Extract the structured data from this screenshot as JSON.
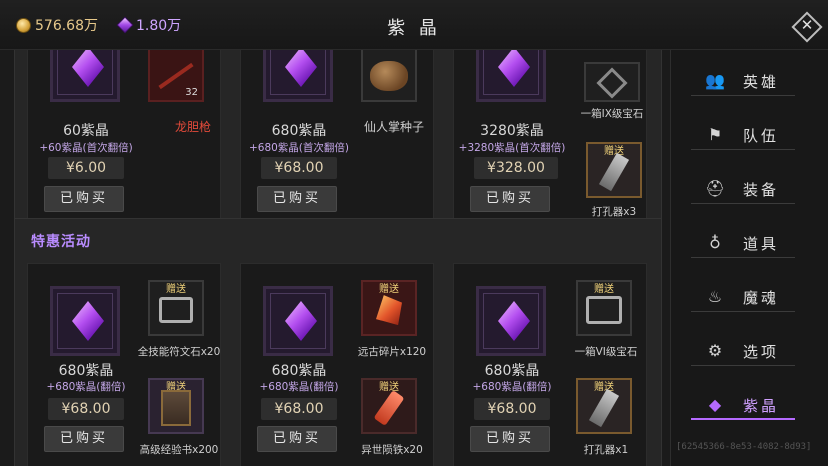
{
  "header": {
    "gold": "576.68万",
    "gems": "1.80万",
    "title": "紫 晶",
    "close": "✕"
  },
  "top_cards": [
    {
      "amount": "60紫晶",
      "bonus": "+60紫晶(首次翻倍)",
      "price": "¥6.00",
      "button": "已购买",
      "gift": {
        "name": "龙胆枪",
        "count": "32",
        "name_color": "#e24a3a"
      }
    },
    {
      "amount": "680紫晶",
      "bonus": "+680紫晶(首次翻倍)",
      "price": "¥68.00",
      "button": "已购买",
      "gift": {
        "name": "仙人掌种子"
      }
    },
    {
      "amount": "3280紫晶",
      "bonus": "+3280紫晶(首次翻倍)",
      "price": "¥328.00",
      "button": "已购买",
      "gift1": {
        "name": "一箱IX级宝石"
      },
      "gift2": {
        "tag": "赠送",
        "name": "打孔器x3"
      }
    }
  ],
  "special": {
    "title": "特惠活动",
    "cards": [
      {
        "amount": "680紫晶",
        "bonus": "+680紫晶(翻倍)",
        "price": "¥68.00",
        "button": "已购买",
        "gift1": {
          "tag": "赠送",
          "name": "全技能符文石x20"
        },
        "gift2": {
          "tag": "赠送",
          "name": "高级经验书x200"
        }
      },
      {
        "amount": "680紫晶",
        "bonus": "+680紫晶(翻倍)",
        "price": "¥68.00",
        "button": "已购买",
        "gift1": {
          "tag": "赠送",
          "name": "远古碎片x120"
        },
        "gift2": {
          "tag": "赠送",
          "name": "异世陨铁x20"
        }
      },
      {
        "amount": "680紫晶",
        "bonus": "+680紫晶(翻倍)",
        "price": "¥68.00",
        "button": "已购买",
        "gift1": {
          "tag": "赠送",
          "name": "一箱VI级宝石"
        },
        "gift2": {
          "tag": "赠送",
          "name": "打孔器x1"
        }
      }
    ]
  },
  "sidebar": {
    "items": [
      {
        "label": "英雄",
        "icon": "heroes-icon"
      },
      {
        "label": "队伍",
        "icon": "flag-icon"
      },
      {
        "label": "装备",
        "icon": "helmet-icon"
      },
      {
        "label": "道具",
        "icon": "bag-icon"
      },
      {
        "label": "魔魂",
        "icon": "flame-icon"
      },
      {
        "label": "选项",
        "icon": "gear-icon"
      },
      {
        "label": "紫晶",
        "icon": "gem-icon",
        "active": true
      }
    ]
  },
  "footer_id": "[62545366-8e53-4082-8d93]",
  "colors": {
    "accent": "#b56aff",
    "gold": "#e7c98b",
    "red_name": "#e24a3a",
    "gift_tag": "#f0d27a"
  }
}
